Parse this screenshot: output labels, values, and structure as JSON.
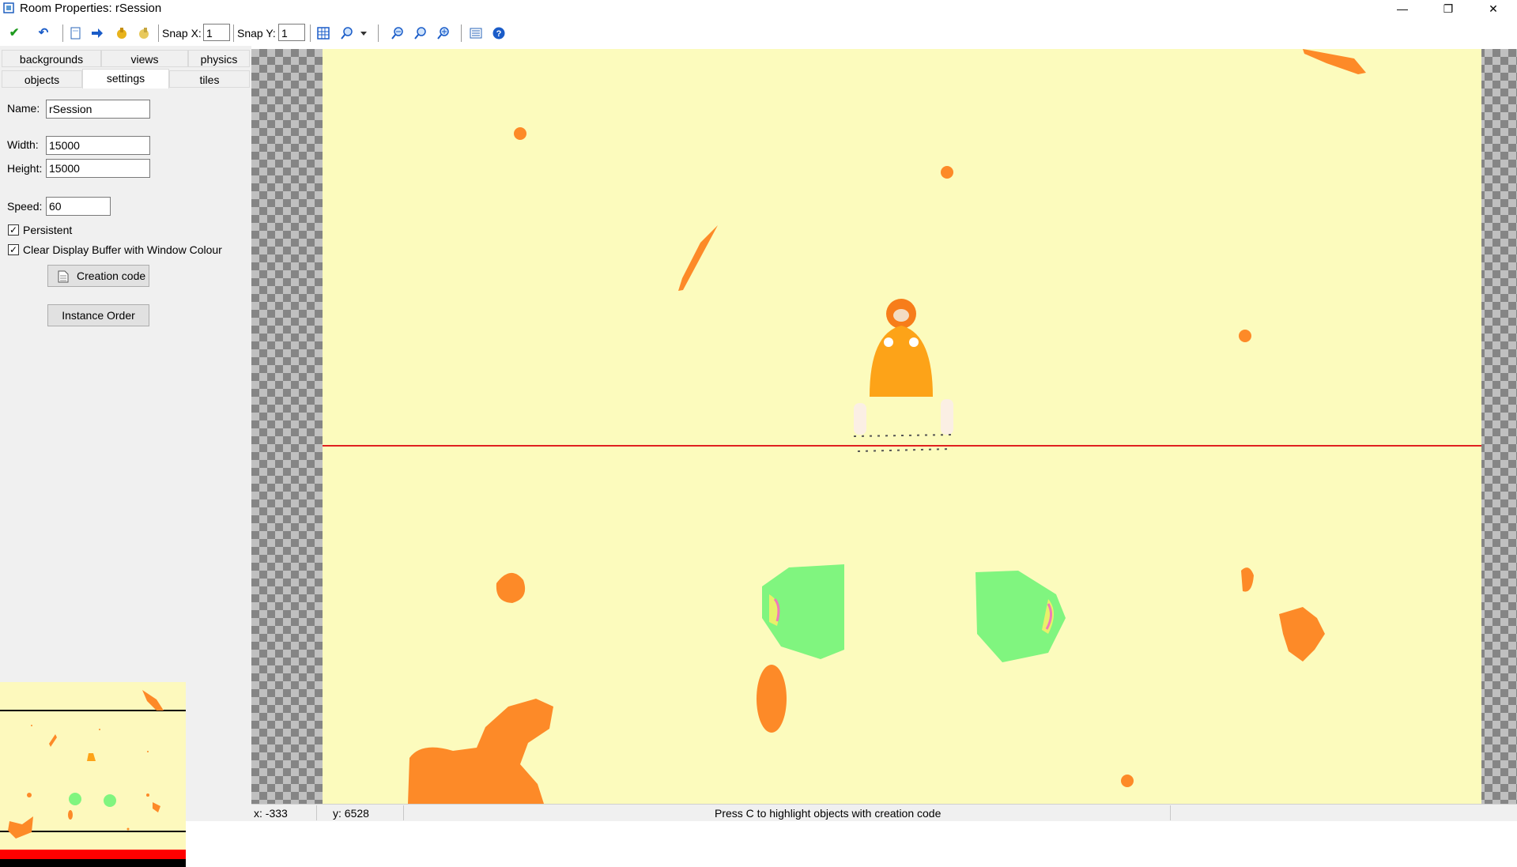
{
  "window": {
    "title": "Room Properties: rSession",
    "minimize": "—",
    "restore": "❐",
    "close": "✕"
  },
  "toolbar": {
    "ok_icon": "✔",
    "undo_icon": "↶",
    "snap_x_label": "Snap X:",
    "snap_x_value": "1",
    "snap_y_label": "Snap Y:",
    "snap_y_value": "1"
  },
  "tabs": {
    "backgrounds": "backgrounds",
    "views": "views",
    "physics": "physics",
    "objects": "objects",
    "settings": "settings",
    "tiles": "tiles",
    "active": "settings"
  },
  "settings": {
    "name_label": "Name:",
    "name_value": "rSession",
    "width_label": "Width:",
    "width_value": "15000",
    "height_label": "Height:",
    "height_value": "15000",
    "speed_label": "Speed:",
    "speed_value": "60",
    "persistent_label": "Persistent",
    "persistent_checked": true,
    "clear_label": "Clear Display Buffer with Window Colour",
    "clear_checked": true,
    "creation_code_label": "Creation code",
    "instance_order_label": "Instance Order"
  },
  "status": {
    "x": "x: -333",
    "y": "y: 6528",
    "hint": "Press C to highlight objects with creation code"
  },
  "colors": {
    "room_background": "#fcfbbd",
    "blob_orange": "#fd8a28",
    "character_orange": "#fda318",
    "enemy_green": "#80f57f",
    "guide_line_red": "#e02020"
  }
}
